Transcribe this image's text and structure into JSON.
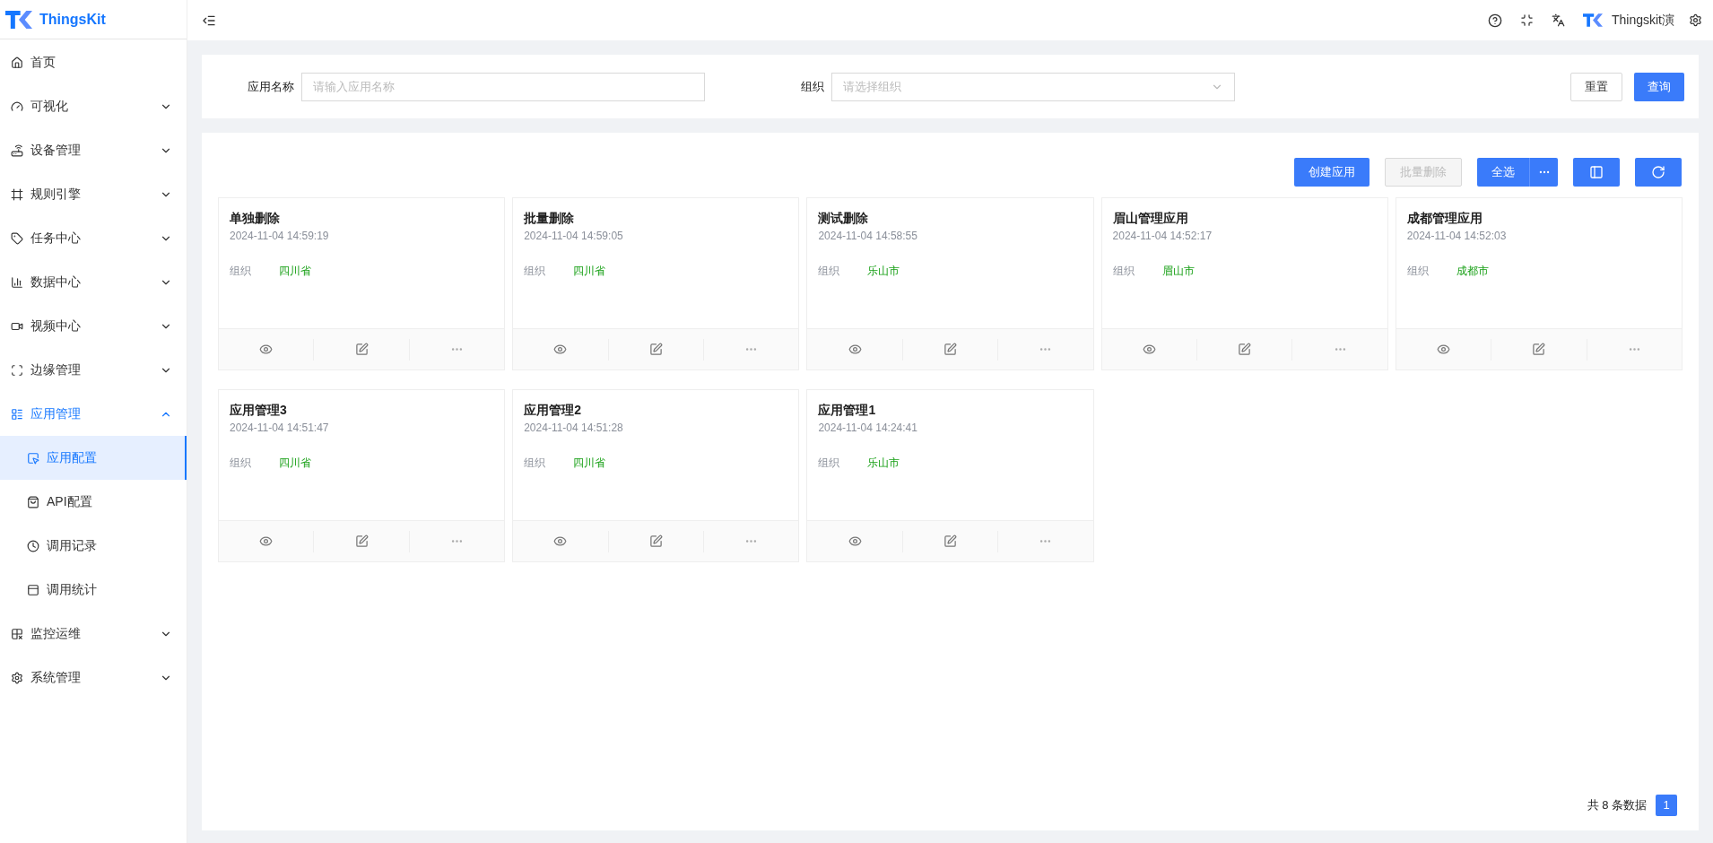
{
  "brand": {
    "name": "ThingsKit"
  },
  "header": {
    "user": "Thingskit演"
  },
  "sidebar": {
    "items": [
      {
        "label": "首页",
        "selected": false
      },
      {
        "label": "可视化",
        "selected": false,
        "expanded": false
      },
      {
        "label": "设备管理",
        "selected": false,
        "expanded": false
      },
      {
        "label": "规则引擎",
        "selected": false,
        "expanded": false
      },
      {
        "label": "任务中心",
        "selected": false,
        "expanded": false
      },
      {
        "label": "数据中心",
        "selected": false,
        "expanded": false
      },
      {
        "label": "视频中心",
        "selected": false,
        "expanded": false
      },
      {
        "label": "边缘管理",
        "selected": false,
        "expanded": false
      },
      {
        "label": "应用管理",
        "selected": true,
        "expanded": true,
        "children": [
          {
            "label": "应用配置",
            "selected": true
          },
          {
            "label": "API配置",
            "selected": false
          },
          {
            "label": "调用记录",
            "selected": false
          },
          {
            "label": "调用统计",
            "selected": false
          }
        ]
      },
      {
        "label": "监控运维",
        "selected": false,
        "expanded": false
      },
      {
        "label": "系统管理",
        "selected": false,
        "expanded": false
      }
    ]
  },
  "filters": [
    {
      "label": "应用名称",
      "kind": "input",
      "placeholder": "请输入应用名称"
    },
    {
      "label": "组织",
      "kind": "select",
      "placeholder": "请选择组织"
    }
  ],
  "filter_buttons": [
    {
      "label": "重置",
      "primary": false
    },
    {
      "label": "查询",
      "primary": true
    }
  ],
  "toolbar": {
    "create": {
      "label": "创建应用",
      "disabled": false
    },
    "batch_delete": {
      "label": "批量删除",
      "disabled": true
    },
    "select_all": {
      "label": "全选"
    }
  },
  "cards": [
    {
      "title": "单独删除",
      "time": "2024-11-04 14:59:19",
      "org_label": "组织",
      "org": "四川省"
    },
    {
      "title": "批量删除",
      "time": "2024-11-04 14:59:05",
      "org_label": "组织",
      "org": "四川省"
    },
    {
      "title": "测试删除",
      "time": "2024-11-04 14:58:55",
      "org_label": "组织",
      "org": "乐山市"
    },
    {
      "title": "眉山管理应用",
      "time": "2024-11-04 14:52:17",
      "org_label": "组织",
      "org": "眉山市"
    },
    {
      "title": "成都管理应用",
      "time": "2024-11-04 14:52:03",
      "org_label": "组织",
      "org": "成都市"
    },
    {
      "title": "应用管理3",
      "time": "2024-11-04 14:51:47",
      "org_label": "组织",
      "org": "四川省"
    },
    {
      "title": "应用管理2",
      "time": "2024-11-04 14:51:28",
      "org_label": "组织",
      "org": "四川省"
    },
    {
      "title": "应用管理1",
      "time": "2024-11-04 14:24:41",
      "org_label": "组织",
      "org": "乐山市"
    }
  ],
  "pagination": {
    "total": "共 8 条数据",
    "pages": [
      {
        "label": "1",
        "selected": true
      }
    ]
  }
}
